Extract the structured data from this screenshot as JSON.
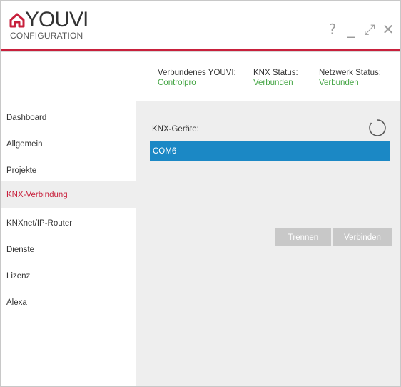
{
  "app": {
    "logo_word": "YOUVI",
    "logo_sub": "CONFIGURATION",
    "brand_color": "#c8203c"
  },
  "window_controls": {
    "help": "?",
    "minimize": "_",
    "maximize": "⤢",
    "close": "✕"
  },
  "status": {
    "connected_youvi_label": "Verbundenes YOUVI:",
    "connected_youvi_value": "Controlpro",
    "knx_label": "KNX Status:",
    "knx_value": "Verbunden",
    "network_label": "Netzwerk Status:",
    "network_value": "Verbunden",
    "ok_color": "#46a646"
  },
  "sidebar": {
    "items": [
      {
        "label": "Dashboard"
      },
      {
        "label": "Allgemein"
      },
      {
        "label": "Projekte"
      },
      {
        "label": "KNX-Verbindung",
        "active": true
      },
      {
        "label": "KNXnet/IP-Router"
      },
      {
        "label": "Dienste"
      },
      {
        "label": "Lizenz"
      },
      {
        "label": "Alexa"
      }
    ]
  },
  "main": {
    "devices_label": "KNX-Geräte:",
    "refresh_icon": "refresh-icon",
    "devices": [
      {
        "name": "COM6",
        "selected": true
      }
    ],
    "disconnect_label": "Trennen",
    "connect_label": "Verbinden",
    "selection_color": "#1b88c5"
  }
}
